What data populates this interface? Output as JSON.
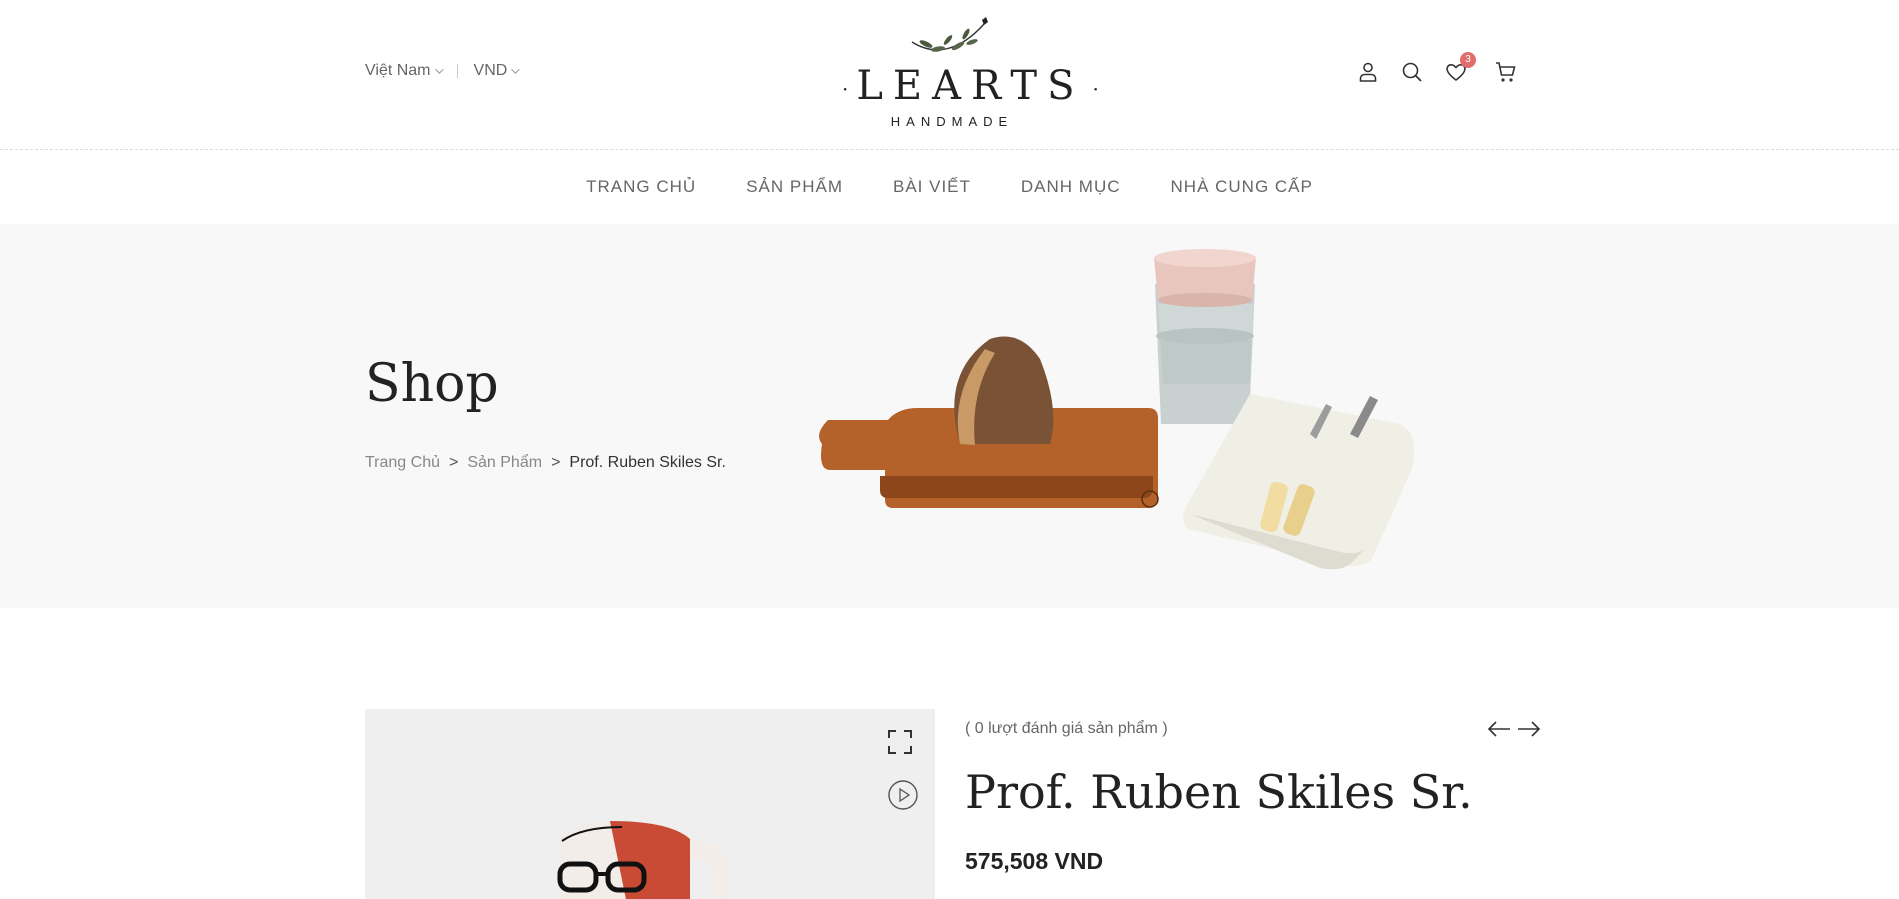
{
  "header": {
    "country": "Việt Nam",
    "currency": "VND",
    "logo": {
      "wordmark": "LEARTS",
      "tagline": "HANDMADE"
    },
    "wishlist_count": "3",
    "icons": [
      "user-icon",
      "search-icon",
      "heart-icon",
      "cart-icon"
    ]
  },
  "nav": {
    "items": [
      "TRANG CHỦ",
      "SẢN PHẨM",
      "BÀI VIẾT",
      "DANH MỤC",
      "NHÀ CUNG CẤP"
    ]
  },
  "hero": {
    "title": "Shop",
    "breadcrumb": {
      "home": "Trang Chủ",
      "section": "Sản Phẩm",
      "separator": ">",
      "current": "Prof. Ruben Skiles Sr."
    }
  },
  "product": {
    "reviews": "( 0 lượt đánh giá sản phẩm )",
    "title": "Prof. Ruben Skiles Sr.",
    "price": "575,508 VND"
  },
  "colors": {
    "badge": "#e06c6c",
    "hero_bg": "#f8f8f9",
    "gallery_bg": "#efefef"
  }
}
